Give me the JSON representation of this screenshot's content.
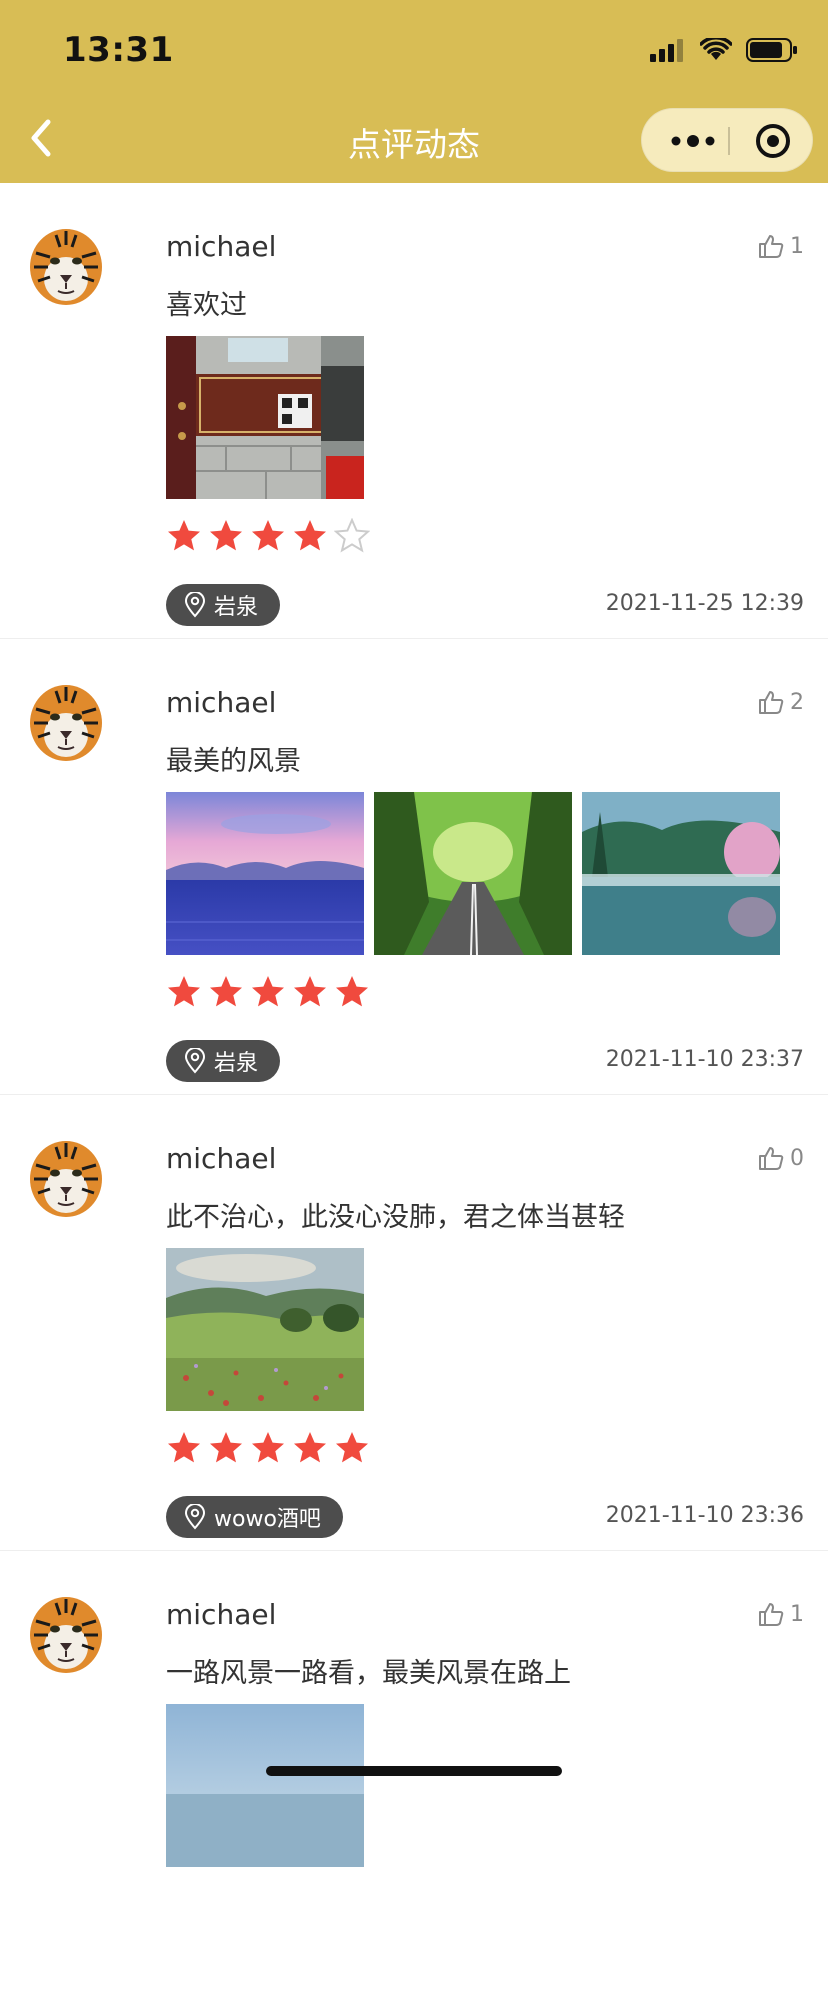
{
  "status_bar": {
    "time": "13:31"
  },
  "nav": {
    "title": "点评动态"
  },
  "colors": {
    "nav_bg": "#d8bd55",
    "star_on": "#f04a3e",
    "star_off": "#cccccc",
    "badge_bg": "#4d4d4d"
  },
  "posts": [
    {
      "username": "michael",
      "likes": "1",
      "content": "喜欢过",
      "rating": 4,
      "location": "岩泉",
      "time": "2021-11-25 12:39",
      "photos": [
        "sign"
      ]
    },
    {
      "username": "michael",
      "likes": "2",
      "content": "最美的风景",
      "rating": 5,
      "location": "岩泉",
      "time": "2021-11-10 23:37",
      "photos": [
        "sea",
        "road",
        "lake"
      ]
    },
    {
      "username": "michael",
      "likes": "0",
      "content": "此不治心，此没心没肺，君之体当甚轻",
      "rating": 5,
      "location": "wowo酒吧",
      "time": "2021-11-10 23:36",
      "photos": [
        "field"
      ]
    },
    {
      "username": "michael",
      "likes": "1",
      "content": "一路风景一路看，最美风景在路上",
      "photos": [
        "sky"
      ]
    }
  ]
}
